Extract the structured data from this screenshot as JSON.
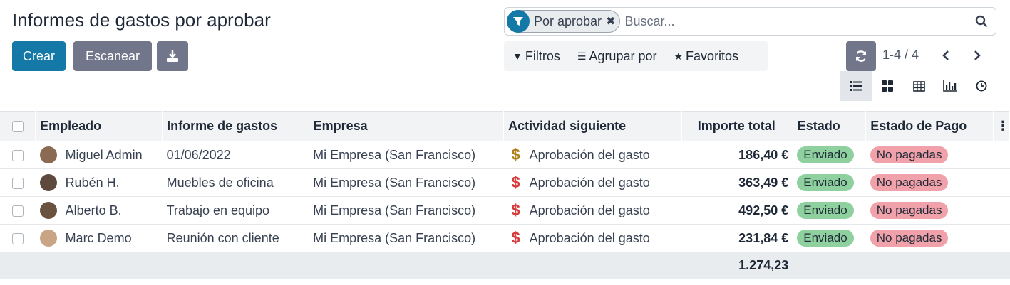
{
  "page": {
    "title": "Informes de gastos por aprobar"
  },
  "toolbar": {
    "create_label": "Crear",
    "scan_label": "Escanear"
  },
  "search": {
    "facet_label": "Por aprobar",
    "placeholder": "Buscar..."
  },
  "filters": {
    "filters_label": "Filtros",
    "group_label": "Agrupar por",
    "favorites_label": "Favoritos"
  },
  "pager": {
    "value": "1-4 / 4"
  },
  "colors": {
    "primary": "#1479a6",
    "secondary": "#71768a",
    "sent": "#8fd19e",
    "unpaid": "#f1a1a9",
    "dollar_warning": "#b07d1a",
    "dollar_danger": "#d63b3b"
  },
  "table": {
    "columns": {
      "employee": "Empleado",
      "report": "Informe de gastos",
      "company": "Empresa",
      "activity": "Actividad siguiente",
      "total": "Importe total",
      "state": "Estado",
      "payment_state": "Estado de Pago"
    },
    "rows": [
      {
        "employee": "Miguel Admin",
        "report": "01/06/2022",
        "company": "Mi Empresa (San Francisco)",
        "activity": "Aprobación del gasto",
        "activity_icon": "dollar-warning",
        "total": "186,40 €",
        "state": "Enviado",
        "payment_state": "No pagadas"
      },
      {
        "employee": "Rubén H.",
        "report": "Muebles de oficina",
        "company": "Mi Empresa (San Francisco)",
        "activity": "Aprobación del gasto",
        "activity_icon": "dollar-danger",
        "total": "363,49 €",
        "state": "Enviado",
        "payment_state": "No pagadas"
      },
      {
        "employee": "Alberto B.",
        "report": "Trabajo en equipo",
        "company": "Mi Empresa (San Francisco)",
        "activity": "Aprobación del gasto",
        "activity_icon": "dollar-danger",
        "total": "492,50 €",
        "state": "Enviado",
        "payment_state": "No pagadas"
      },
      {
        "employee": "Marc Demo",
        "report": "Reunión con cliente",
        "company": "Mi Empresa (San Francisco)",
        "activity": "Aprobación del gasto",
        "activity_icon": "dollar-danger",
        "total": "231,84 €",
        "state": "Enviado",
        "payment_state": "No pagadas"
      }
    ],
    "footer_total": "1.274,23"
  }
}
